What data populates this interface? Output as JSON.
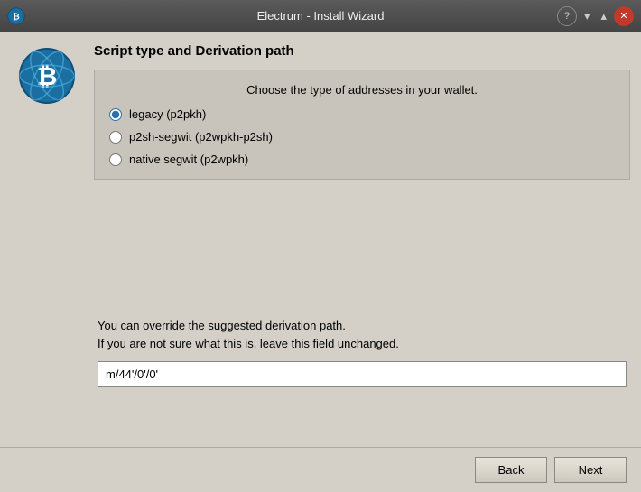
{
  "titlebar": {
    "title": "Electrum - Install Wizard",
    "help_label": "?",
    "collapse_label": "▾",
    "expand_label": "▴",
    "close_label": "✕"
  },
  "section": {
    "title": "Script type and Derivation path",
    "hint": "Choose the type of addresses in your wallet."
  },
  "radio_options": [
    {
      "id": "legacy",
      "label": "legacy (p2pkh)",
      "checked": true
    },
    {
      "id": "p2sh-segwit",
      "label": "p2sh-segwit (p2wpkh-p2sh)",
      "checked": false
    },
    {
      "id": "native-segwit",
      "label": "native segwit (p2wpkh)",
      "checked": false
    }
  ],
  "derivation": {
    "hint_line1": "You can override the suggested derivation path.",
    "hint_line2": "If you are not sure what this is, leave this field unchanged.",
    "value": "m/44'/0'/0'"
  },
  "footer": {
    "back_label": "Back",
    "next_label": "Next"
  }
}
